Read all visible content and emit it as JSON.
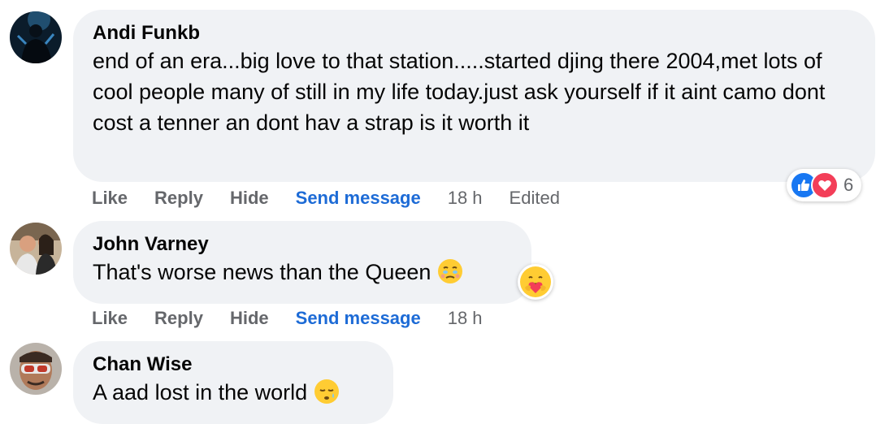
{
  "comments": [
    {
      "author": "Andi Funkb",
      "text": "end of an era...big love to that station.....started djing there 2004,met lots of cool people many of still in my life today.just ask yourself if it aint camo dont cost a tenner an dont hav a strap is it worth it",
      "actions": {
        "like": "Like",
        "reply": "Reply",
        "hide": "Hide",
        "send": "Send message"
      },
      "time": "18 h",
      "edited": "Edited",
      "reactions": {
        "icons": [
          "like-icon",
          "love-icon"
        ],
        "count": "6"
      }
    },
    {
      "author": "John Varney",
      "text": "That's worse news than the Queen",
      "actions": {
        "like": "Like",
        "reply": "Reply",
        "hide": "Hide",
        "send": "Send message"
      },
      "time": "18 h",
      "reactions": {
        "icons": [
          "care-icon"
        ]
      }
    },
    {
      "author": "Chan Wise",
      "text": "A aad lost in the world"
    }
  ],
  "colors": {
    "bubble": "#f0f2f5",
    "action_gray": "#65676b",
    "send_blue": "#1d6bd6",
    "like_blue": "#1877f2",
    "love_red": "#f33e58"
  }
}
